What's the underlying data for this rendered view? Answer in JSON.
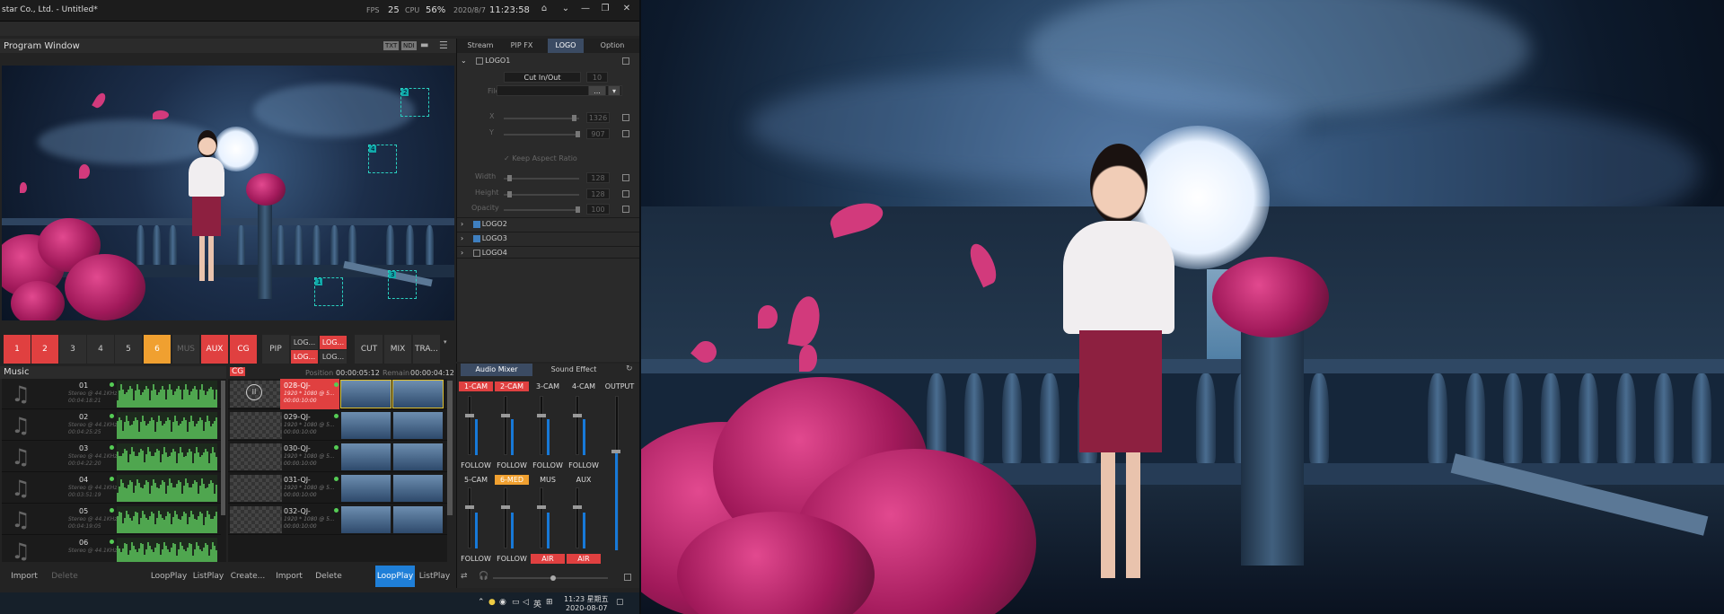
{
  "window": {
    "title": "star Co., Ltd. - Untitled*"
  },
  "stats": {
    "fps_label": "FPS",
    "fps_value": "25",
    "cpu_label": "CPU",
    "cpu_value": "56%",
    "date": "2020/8/7",
    "time": "11:23:58"
  },
  "program": {
    "title": "Program Window",
    "btn1": "TXT",
    "btn2": "NDI"
  },
  "switcher": {
    "buttons": [
      "1",
      "2",
      "3",
      "4",
      "5",
      "6",
      "MUS",
      "AUX",
      "CG",
      "PIP"
    ],
    "pairs": [
      "LOG...",
      "LOG...",
      "LOG...",
      "LOG..."
    ],
    "transitions": [
      "CUT",
      "MIX",
      "TRA..."
    ]
  },
  "right_panel": {
    "tabs": [
      "Stream",
      "PIP FX",
      "LOGO",
      "Option"
    ],
    "logo1": "LOGO1",
    "effect": "Cut In/Out",
    "effect_num": "10",
    "file_label": "File",
    "browse": "...",
    "x_label": "X",
    "x_value": "1326",
    "y_label": "Y",
    "y_value": "907",
    "keep_aspect": "Keep Aspect Ratio",
    "width_label": "Width",
    "width_value": "128",
    "height_label": "Height",
    "height_value": "128",
    "opacity_label": "Opacity",
    "opacity_value": "100",
    "logo2": "LOGO2",
    "logo3": "LOGO3",
    "logo4": "LOGO4"
  },
  "music": {
    "title": "Music",
    "items": [
      {
        "num": "01",
        "desc": "Stereo @ 44.1KHz",
        "time": "00:04:18:21"
      },
      {
        "num": "02",
        "desc": "Stereo @ 44.1KHz",
        "time": "00:04:25:25"
      },
      {
        "num": "03",
        "desc": "Stereo @ 44.1KHz",
        "time": "00:04:22:20"
      },
      {
        "num": "04",
        "desc": "Stereo @ 44.1KHz",
        "time": "00:03:51:19"
      },
      {
        "num": "05",
        "desc": "Stereo @ 44.1KHz",
        "time": "00:04:19:05"
      },
      {
        "num": "06",
        "desc": "Stereo @ 44.1KHz",
        "time": ""
      }
    ],
    "import": "Import",
    "delete": "Delete",
    "loop": "LoopPlay",
    "list": "ListPlay"
  },
  "cg": {
    "title": "CG",
    "position_label": "Position",
    "position_value": "00:00:05:12",
    "remain_label": "Remain",
    "remain_value": "00:00:04:12",
    "items": [
      {
        "name": "028-QJ-",
        "sub": "1920 * 1080 @ 5...",
        "time": "00:00:10:00"
      },
      {
        "name": "029-QJ-",
        "sub": "1920 * 1080 @ 5...",
        "time": "00:00:10:00"
      },
      {
        "name": "030-QJ-",
        "sub": "1920 * 1080 @ 5...",
        "time": "00:00:10:00"
      },
      {
        "name": "031-QJ-",
        "sub": "1920 * 1080 @ 5...",
        "time": "00:00:10:00"
      },
      {
        "name": "032-QJ-",
        "sub": "1920 * 1080 @ 5...",
        "time": "00:00:10:00"
      }
    ],
    "create": "Create...",
    "import": "Import",
    "delete": "Delete",
    "loop": "LoopPlay",
    "list": "ListPlay"
  },
  "mixer": {
    "tab1": "Audio Mixer",
    "tab2": "Sound Effect",
    "row1": [
      "1-CAM",
      "2-CAM",
      "3-CAM",
      "4-CAM"
    ],
    "output": "OUTPUT",
    "follow": "FOLLOW",
    "row2": [
      "5-CAM",
      "6-MED",
      "MUS",
      "AUX"
    ],
    "air": "AIR"
  },
  "taskbar": {
    "ime": "英",
    "time": "11:23 星期五",
    "date": "2020-08-07"
  },
  "colors": {
    "accent_red": "#e04040",
    "accent_orange": "#f0a030",
    "tab_blue": "#3b4b63",
    "meter_blue": "#1779d8"
  }
}
